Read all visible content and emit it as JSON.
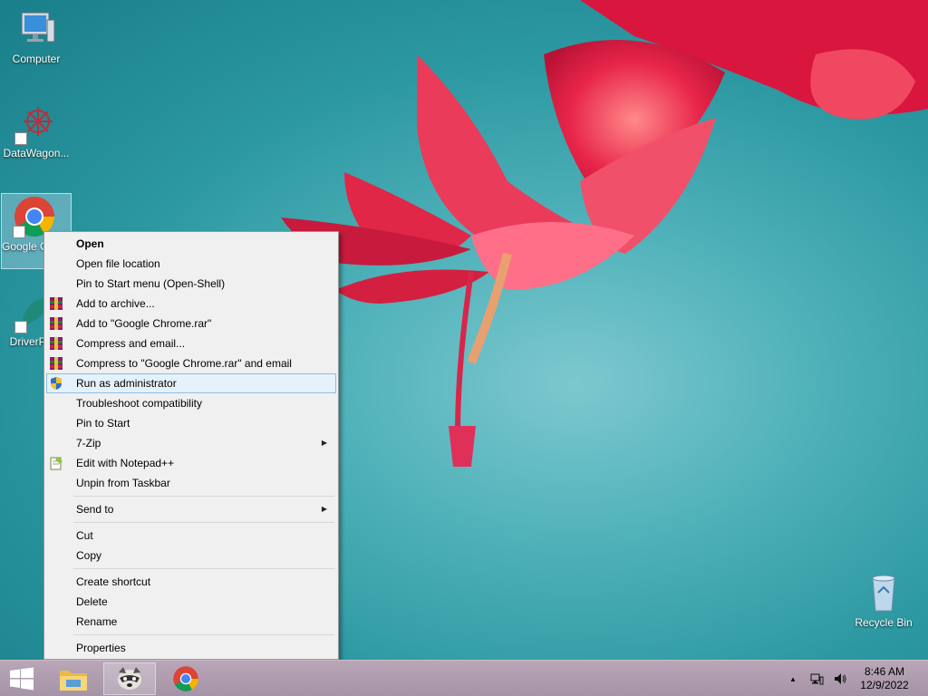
{
  "desktop": {
    "icons": [
      {
        "label": "Computer"
      },
      {
        "label": "DataWagon..."
      },
      {
        "label": "Google Chrome"
      },
      {
        "label": "DriverPack"
      },
      {
        "label": "Recycle Bin"
      }
    ]
  },
  "context_menu": {
    "items": {
      "open": "Open",
      "open_file_location": "Open file location",
      "pin_start_menu": "Pin to Start menu (Open-Shell)",
      "add_archive": "Add to archive...",
      "add_rar": "Add to \"Google Chrome.rar\"",
      "compress_email": "Compress and email...",
      "compress_rar_email": "Compress to \"Google Chrome.rar\" and email",
      "run_admin": "Run as administrator",
      "troubleshoot": "Troubleshoot compatibility",
      "pin_start": "Pin to Start",
      "seven_zip": "7-Zip",
      "notepad": "Edit with Notepad++",
      "unpin_taskbar": "Unpin from Taskbar",
      "send_to": "Send to",
      "cut": "Cut",
      "copy": "Copy",
      "create_shortcut": "Create shortcut",
      "delete": "Delete",
      "rename": "Rename",
      "properties": "Properties"
    },
    "submenu_arrow": "▶"
  },
  "taskbar": {
    "tray_expand": "▲",
    "time": "8:46 AM",
    "date": "12/9/2022"
  },
  "colors": {
    "menu_highlight": "#e5f1fb",
    "menu_highlight_border": "#8dbfe7",
    "taskbar": "#b09eb0"
  }
}
